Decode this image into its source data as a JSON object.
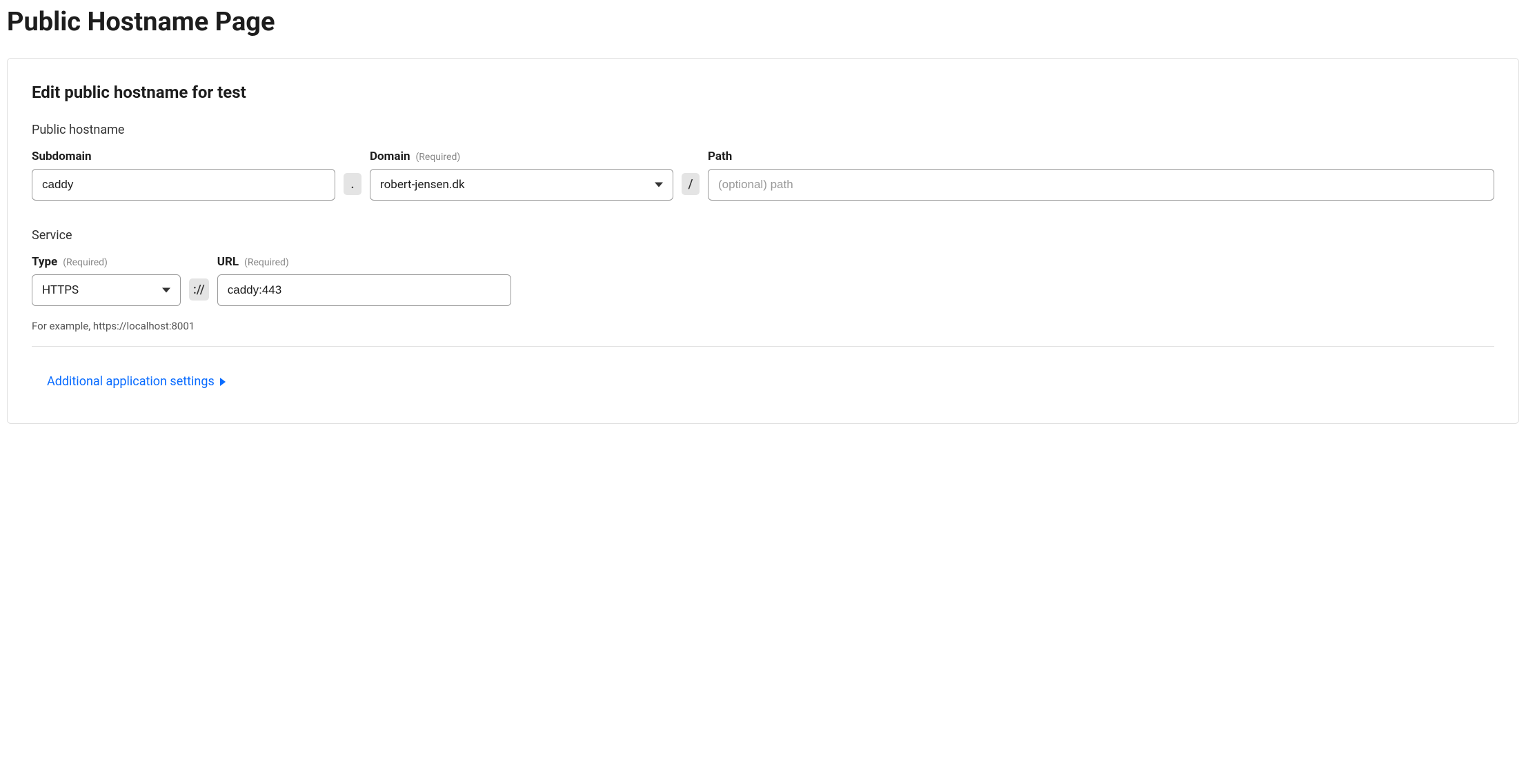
{
  "page": {
    "title": "Public Hostname Page",
    "panelTitle": "Edit public hostname for test"
  },
  "hostname": {
    "sectionLabel": "Public hostname",
    "subdomain": {
      "label": "Subdomain",
      "value": "caddy"
    },
    "domain": {
      "label": "Domain",
      "required": "(Required)",
      "value": "robert-jensen.dk"
    },
    "path": {
      "label": "Path",
      "placeholder": "(optional) path",
      "value": ""
    },
    "dotSeparator": ".",
    "slashSeparator": "/"
  },
  "service": {
    "sectionLabel": "Service",
    "type": {
      "label": "Type",
      "required": "(Required)",
      "value": "HTTPS"
    },
    "url": {
      "label": "URL",
      "required": "(Required)",
      "value": "caddy:443"
    },
    "protocolSeparator": "://",
    "hint": "For example, https://localhost:8001"
  },
  "expand": {
    "label": "Additional application settings"
  }
}
